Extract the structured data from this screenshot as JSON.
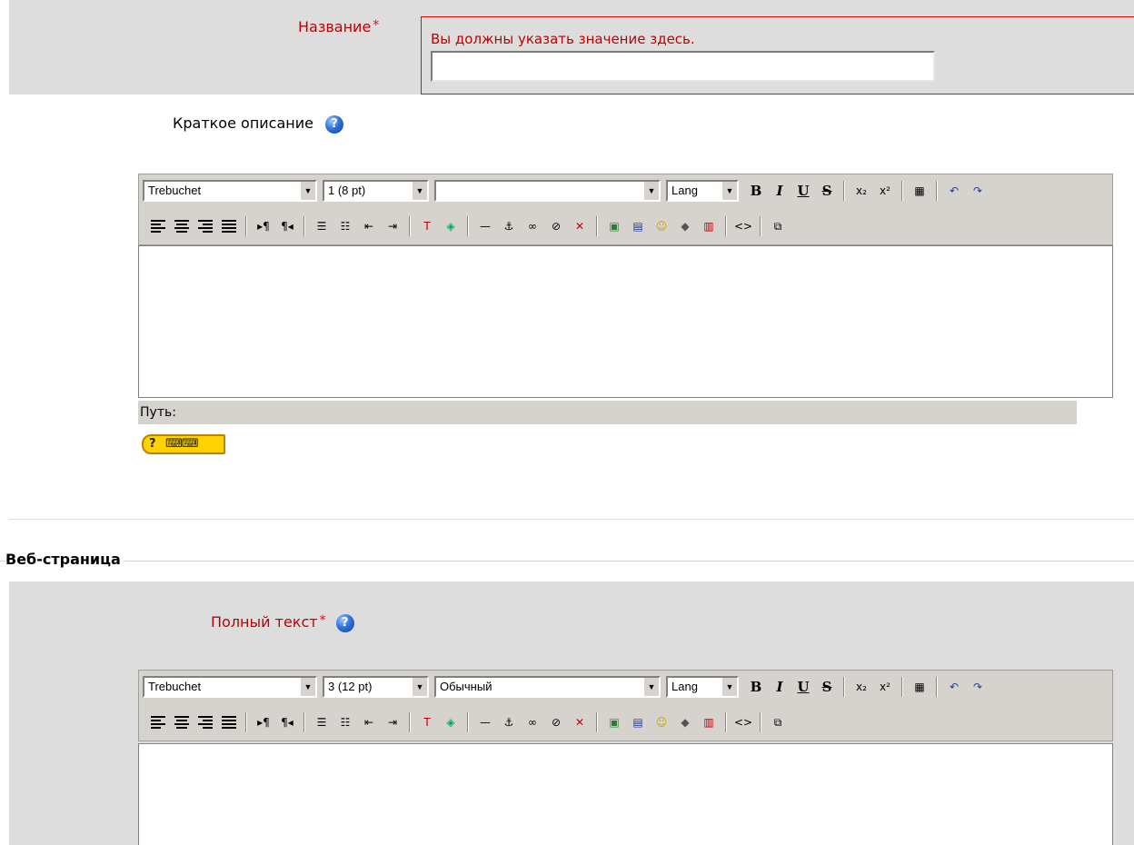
{
  "title_field": {
    "label": "Название",
    "required_mark": "*",
    "error": "Вы должны указать значение здесь.",
    "value": ""
  },
  "summary": {
    "label": "Краткое описание",
    "help_icon": "help-icon",
    "editor": {
      "font": "Trebuchet",
      "size": "1 (8 pt)",
      "format": "",
      "lang": "Lang",
      "path_label": "Путь:",
      "shortcuts_label": "?"
    }
  },
  "section": {
    "legend": "Веб-страница"
  },
  "full_text": {
    "label": "Полный текст",
    "required_mark": "*",
    "editor": {
      "font": "Trebuchet",
      "size": "3 (12 pt)",
      "format": "Обычный",
      "lang": "Lang"
    }
  },
  "toolbar_buttons": {
    "bold": "B",
    "italic": "I",
    "underline": "U",
    "strike": "S",
    "subscript": "x₂",
    "superscript": "x²"
  },
  "colors": {
    "label_red": "#c00000",
    "error_border": "#ff0000",
    "row_bg": "#dddddd",
    "toolbar_bg": "#d6d3ce"
  }
}
